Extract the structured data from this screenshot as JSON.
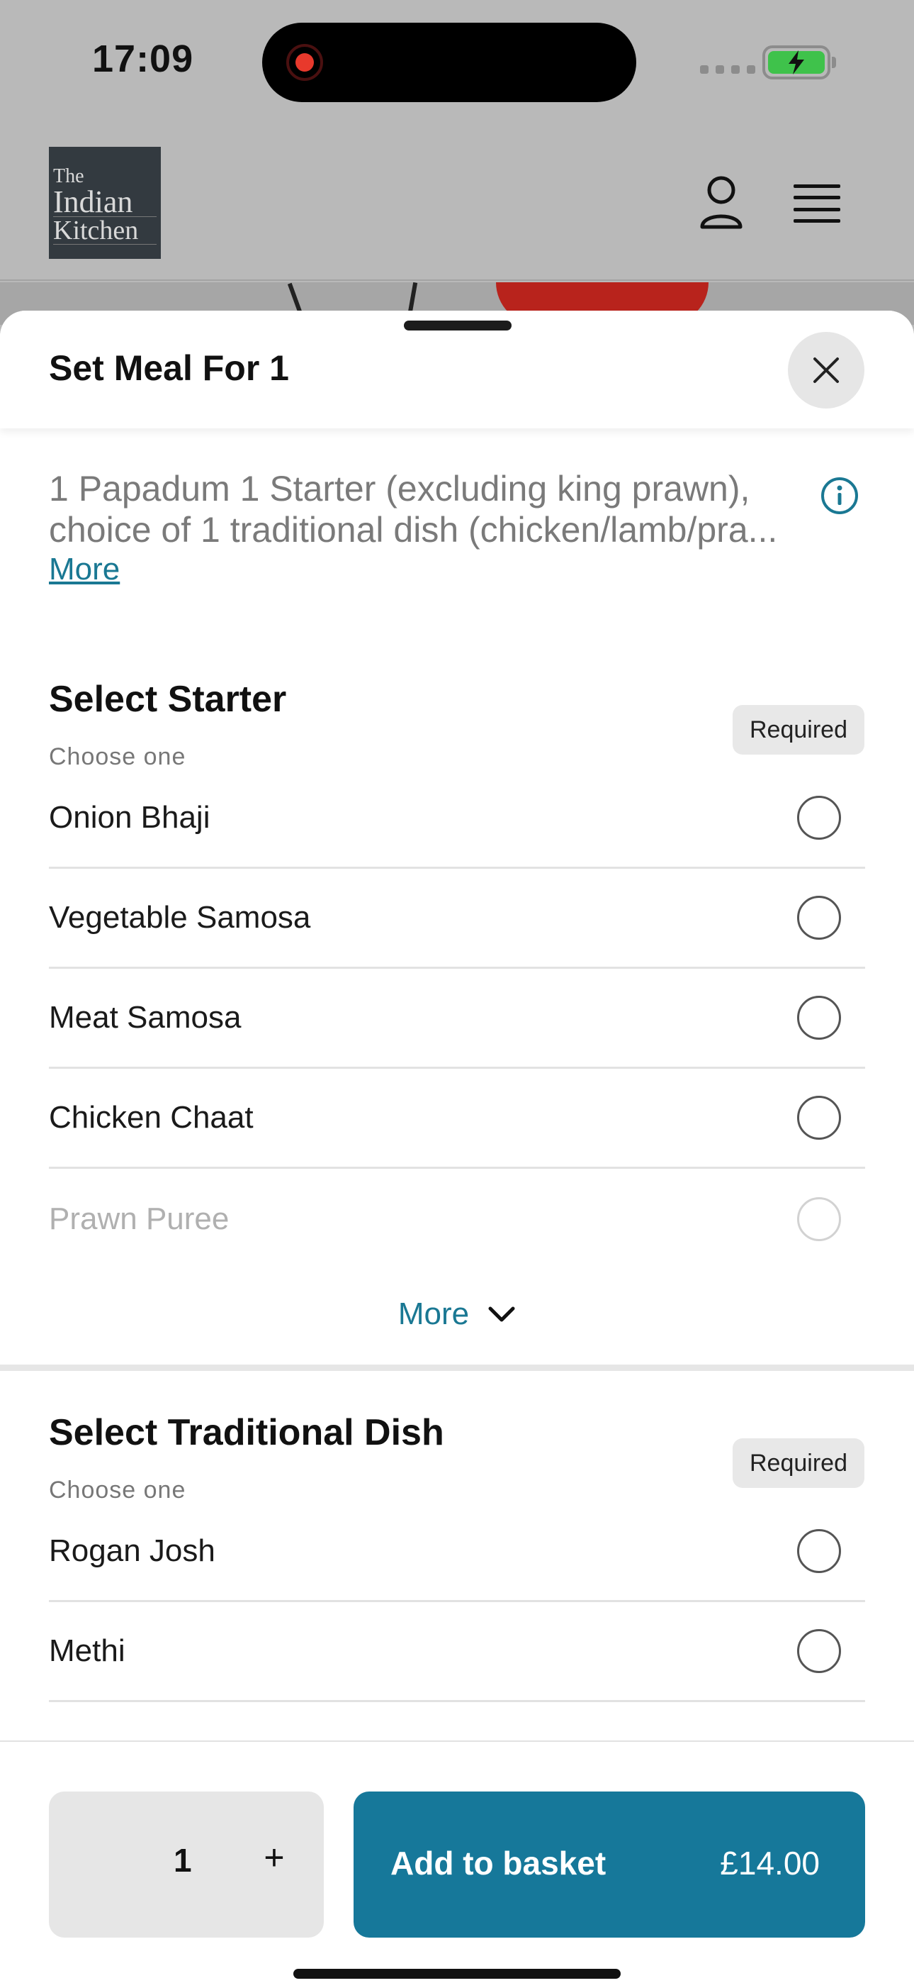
{
  "status_bar": {
    "time": "17:09"
  },
  "site": {
    "logo_line1": "The",
    "logo_line2": "Indian",
    "logo_line3": "Kitchen"
  },
  "modal": {
    "title": "Set Meal For 1",
    "description": "1 Papadum 1 Starter (excluding king prawn), choice of 1 traditional dish (chicken/lamb/pra...",
    "description_more": "More"
  },
  "sections": [
    {
      "title": "Select Starter",
      "subtitle": "Choose one",
      "badge": "Required",
      "options": [
        "Onion Bhaji",
        "Vegetable Samosa",
        "Meat Samosa",
        "Chicken Chaat",
        "Prawn Puree"
      ],
      "more_label": "More"
    },
    {
      "title": "Select Traditional Dish",
      "subtitle": "Choose one",
      "badge": "Required",
      "options": [
        "Rogan Josh",
        "Methi"
      ]
    }
  ],
  "footer": {
    "quantity": "1",
    "plus_label": "+",
    "add_label": "Add to basket",
    "price": "£14.00"
  },
  "colors": {
    "accent": "#16789a",
    "link": "#1a7893"
  }
}
